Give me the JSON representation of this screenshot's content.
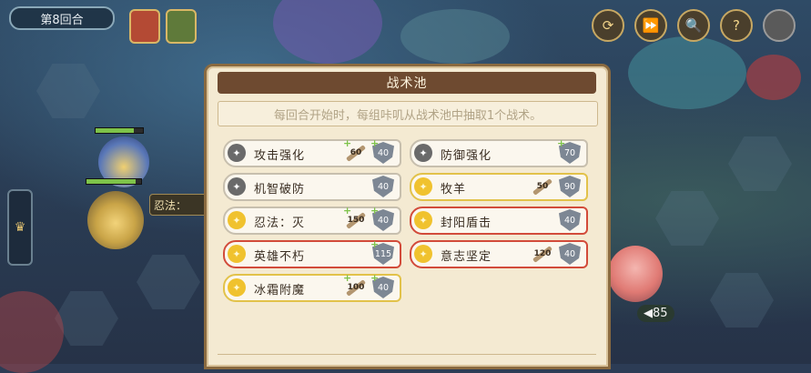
{
  "hud": {
    "round_label": "第8回合",
    "skill_popup": "忍法：",
    "enemy_value": "◀85",
    "top_buttons": [
      {
        "name": "speed-toggle-icon",
        "glyph": "⟳"
      },
      {
        "name": "fast-forward-icon",
        "glyph": "⏩"
      },
      {
        "name": "search-icon",
        "glyph": "🔍"
      },
      {
        "name": "help-icon",
        "glyph": "?"
      },
      {
        "name": "settings-icon",
        "glyph": ""
      }
    ]
  },
  "dialog": {
    "title": "战术池",
    "description": "每回合开始时，每组咔叽从战术池中抽取1个战术。",
    "tactics": [
      {
        "name": "攻击强化",
        "state": "normal",
        "active": false,
        "attack": "60",
        "attack_plus": true,
        "defense": "40",
        "defense_plus": true
      },
      {
        "name": "防御强化",
        "state": "normal",
        "active": false,
        "attack": "",
        "attack_plus": false,
        "defense": "70",
        "defense_plus": true
      },
      {
        "name": "机智破防",
        "state": "normal",
        "active": false,
        "attack": "",
        "attack_plus": false,
        "defense": "40",
        "defense_plus": false
      },
      {
        "name": "牧羊",
        "state": "yellow",
        "active": true,
        "attack": "50",
        "attack_plus": false,
        "defense": "90",
        "defense_plus": false
      },
      {
        "name": "忍法：灭",
        "state": "normal",
        "active": true,
        "attack": "150",
        "attack_plus": true,
        "defense": "40",
        "defense_plus": true
      },
      {
        "name": "封阳盾击",
        "state": "red",
        "active": true,
        "attack": "",
        "attack_plus": false,
        "defense": "40",
        "defense_plus": false
      },
      {
        "name": "英雄不朽",
        "state": "red",
        "active": true,
        "attack": "",
        "attack_plus": false,
        "defense": "115",
        "defense_plus": true
      },
      {
        "name": "意志坚定",
        "state": "red",
        "active": true,
        "attack": "120",
        "attack_plus": false,
        "defense": "40",
        "defense_plus": false
      },
      {
        "name": "冰霜附魔",
        "state": "yellow",
        "active": true,
        "attack": "100",
        "attack_plus": true,
        "defense": "40",
        "defense_plus": true
      }
    ]
  }
}
